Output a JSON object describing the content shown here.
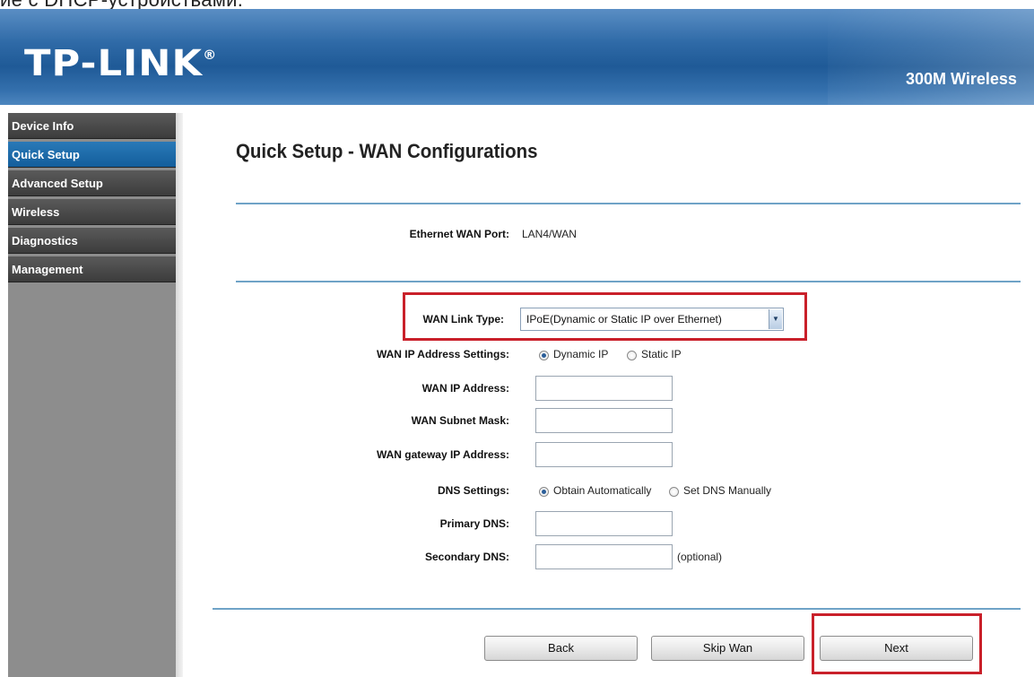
{
  "caption": "ие с DHCP-устройствами.",
  "header": {
    "logo": "TP-LINK",
    "logo_mark": "®",
    "model": "300M Wireless"
  },
  "sidebar": {
    "items": [
      {
        "label": "Device Info",
        "active": false
      },
      {
        "label": "Quick Setup",
        "active": true
      },
      {
        "label": "Advanced Setup",
        "active": false
      },
      {
        "label": "Wireless",
        "active": false
      },
      {
        "label": "Diagnostics",
        "active": false
      },
      {
        "label": "Management",
        "active": false
      }
    ]
  },
  "page": {
    "title": "Quick Setup - WAN Configurations",
    "ethernet_wan_port": {
      "label": "Ethernet WAN Port:",
      "value": "LAN4/WAN"
    },
    "wan_link_type": {
      "label": "WAN Link Type:",
      "value": "IPoE(Dynamic or Static IP over Ethernet)"
    },
    "wan_ip_settings": {
      "label": "WAN IP Address Settings:",
      "option_dynamic": "Dynamic IP",
      "option_static": "Static IP",
      "selected": "Dynamic IP"
    },
    "wan_ip_address": {
      "label": "WAN IP Address:",
      "value": ""
    },
    "wan_subnet_mask": {
      "label": "WAN Subnet Mask:",
      "value": ""
    },
    "wan_gateway": {
      "label": "WAN gateway IP Address:",
      "value": ""
    },
    "dns_settings": {
      "label": "DNS Settings:",
      "option_auto": "Obtain Automatically",
      "option_manual": "Set DNS Manually",
      "selected": "Obtain Automatically"
    },
    "primary_dns": {
      "label": "Primary DNS:",
      "value": ""
    },
    "secondary_dns": {
      "label": "Secondary DNS:",
      "value": "",
      "note": "(optional)"
    }
  },
  "buttons": {
    "back": "Back",
    "skip_wan": "Skip Wan",
    "next": "Next"
  },
  "colors": {
    "header_blue": "#2f6aa7",
    "sidebar_active": "#1a6aaa",
    "highlight_red": "#c9202a",
    "separator": "#6fa3c7"
  }
}
